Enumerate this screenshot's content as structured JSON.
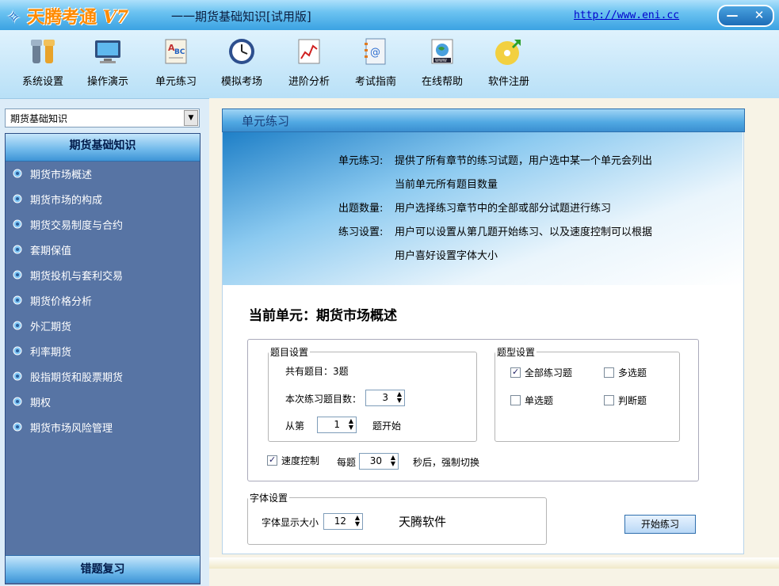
{
  "title_bar": {
    "logo_text": "天腾考通",
    "version": "V7",
    "subtitle": "一一期货基础知识[试用版]",
    "url": "http://www.eni.cc",
    "minimize": "—",
    "close": "✕"
  },
  "toolbar": [
    {
      "label": "系统设置",
      "icon": "settings-icon"
    },
    {
      "label": "操作演示",
      "icon": "monitor-icon"
    },
    {
      "label": "单元练习",
      "icon": "abc-book-icon"
    },
    {
      "label": "模拟考场",
      "icon": "clock-icon"
    },
    {
      "label": "进阶分析",
      "icon": "chart-icon"
    },
    {
      "label": "考试指南",
      "icon": "address-book-icon"
    },
    {
      "label": "在线帮助",
      "icon": "www-icon"
    },
    {
      "label": "软件注册",
      "icon": "cd-icon"
    }
  ],
  "sidebar": {
    "combo_value": "期货基础知识",
    "header": "期货基础知识",
    "items": [
      "期货市场概述",
      "期货市场的构成",
      "期货交易制度与合约",
      "套期保值",
      "期货投机与套利交易",
      "期货价格分析",
      "外汇期货",
      "利率期货",
      "股指期货和股票期货",
      "期权",
      "期货市场风险管理"
    ],
    "footer": "错题复习"
  },
  "main": {
    "header": "单元练习",
    "desc": {
      "line1_key": "单元练习:",
      "line1": "提供了所有章节的练习试题，用户选中某一个单元会列出",
      "line1b": "当前单元所有题目数量",
      "line2_key": "出题数量:",
      "line2": "用户选择练习章节中的全部或部分试题进行练习",
      "line3_key": "练习设置:",
      "line3": "用户可以设置从第几题开始练习、以及速度控制可以根据",
      "line3b": "用户喜好设置字体大小"
    },
    "current_unit": "当前单元：期货市场概述",
    "question_settings": {
      "legend": "题目设置",
      "total": "共有题目：3题",
      "count_label": "本次练习题目数：",
      "count_value": "3",
      "from_label": "从第",
      "from_value": "1",
      "from_suffix": "题开始"
    },
    "type_settings": {
      "legend": "题型设置",
      "all": "全部练习题",
      "multi": "多选题",
      "single": "单选题",
      "judge": "判断题"
    },
    "speed": {
      "label": "速度控制",
      "per_label": "每题",
      "value": "30",
      "suffix": "秒后，强制切换"
    },
    "font_settings": {
      "legend": "字体设置",
      "size_label": "字体显示大小",
      "size_value": "12",
      "sample": "天腾软件"
    },
    "start_button": "开始练习"
  }
}
